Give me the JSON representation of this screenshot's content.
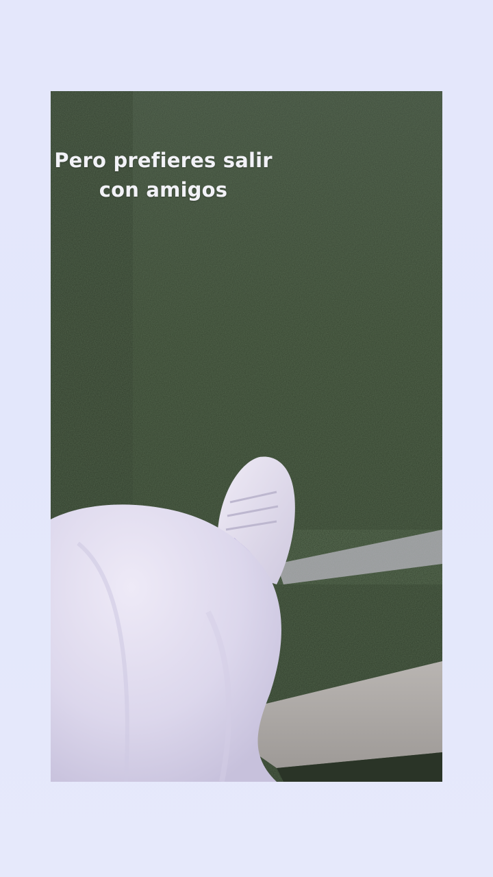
{
  "story": {
    "caption_lines": [
      "Pero prefieres salir",
      "con amigos"
    ]
  },
  "colors": {
    "background": "#e4e7fb",
    "turf": "#36452f",
    "pants": "#e2def0",
    "caption_text": "#f2f2f7"
  }
}
